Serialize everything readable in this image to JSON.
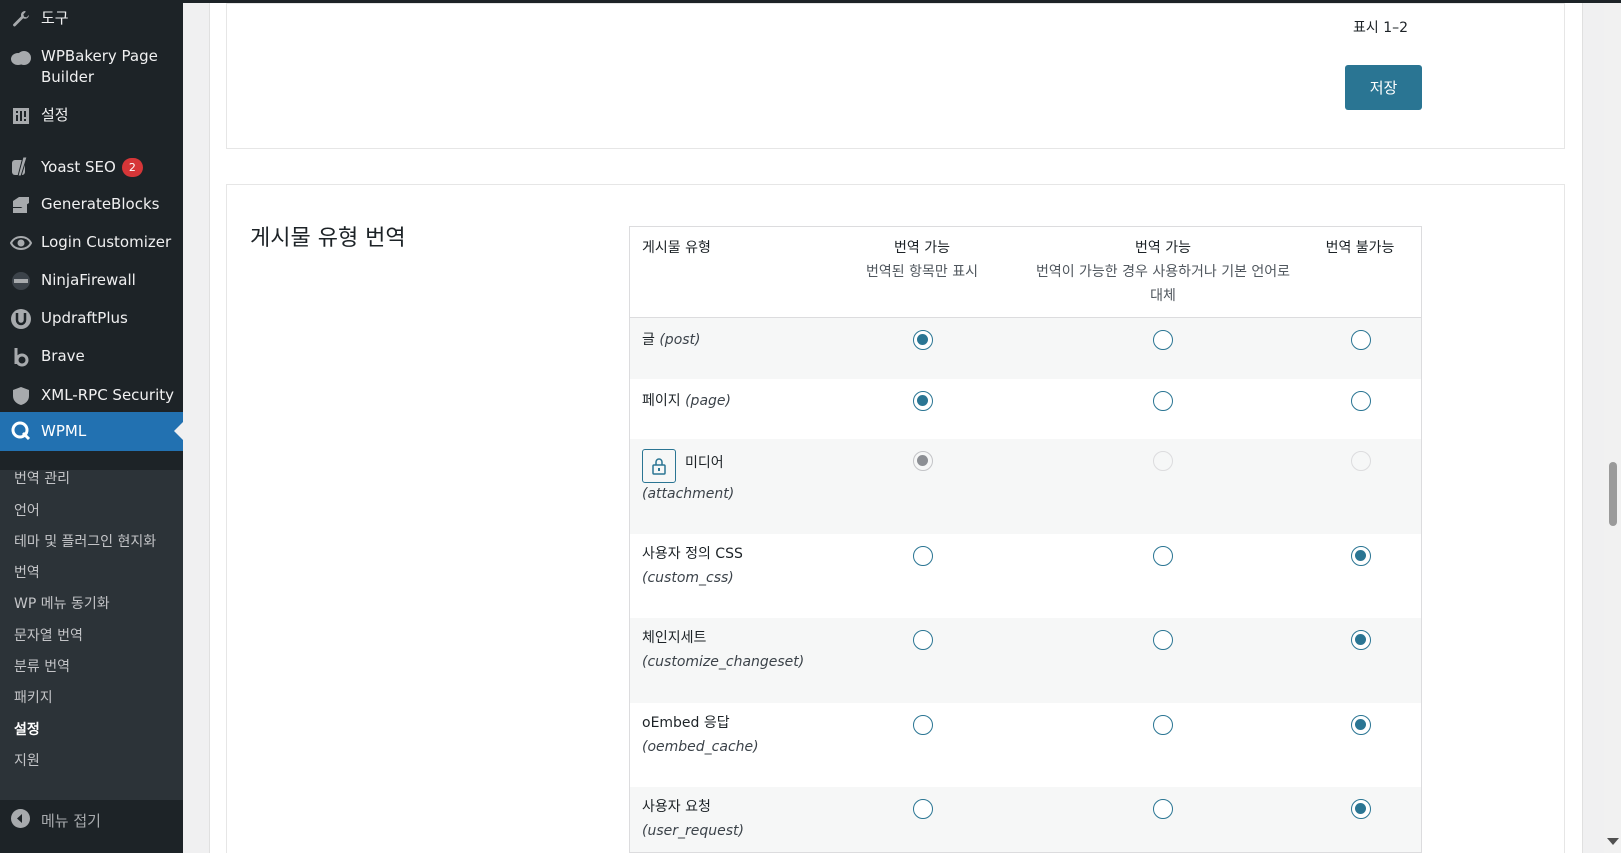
{
  "sidebar": {
    "items": [
      {
        "label": "도구",
        "icon": "wrench-icon"
      },
      {
        "label": "WPBakery Page Builder",
        "icon": "cloud-icon"
      },
      {
        "label": "설정",
        "icon": "settings-icon"
      },
      {
        "label": "Yoast SEO",
        "icon": "yoast-icon",
        "badge": "2"
      },
      {
        "label": "GenerateBlocks",
        "icon": "generateblocks-icon"
      },
      {
        "label": "Login Customizer",
        "icon": "eye-icon"
      },
      {
        "label": "NinjaFirewall",
        "icon": "ninja-icon"
      },
      {
        "label": "UpdraftPlus",
        "icon": "updraft-icon"
      },
      {
        "label": "Brave",
        "icon": "brave-icon"
      },
      {
        "label": "XML-RPC Security",
        "icon": "shield-icon"
      },
      {
        "label": "WPML",
        "icon": "wpml-icon"
      }
    ],
    "wpml_submenu": [
      "번역 관리",
      "언어",
      "테마 및 플러그인 현지화",
      "번역",
      "WP 메뉴 동기화",
      "문자열 번역",
      "분류 번역",
      "패키지",
      "설정",
      "지원"
    ],
    "collapse_label": "메뉴 접기"
  },
  "top_box": {
    "showing": "표시 1–2",
    "save_label": "저장"
  },
  "post_types": {
    "title": "게시물 유형 번역",
    "headers": {
      "type": "게시물 유형",
      "col1_title": "번역 가능",
      "col1_sub": "번역된 항목만 표시",
      "col2_title": "번역 가능",
      "col2_sub": "번역이 가능한 경우 사용하거나 기본 언어로 대체",
      "col3_title": "번역 불가능"
    },
    "rows": [
      {
        "name": "글",
        "slug": "(post)",
        "selected": 1
      },
      {
        "name": "페이지",
        "slug": "(page)",
        "selected": 1
      },
      {
        "name": "미디어",
        "slug": "(attachment)",
        "selected": 1,
        "locked": true
      },
      {
        "name": "사용자 정의 CSS",
        "slug": "(custom_css)",
        "selected": 3
      },
      {
        "name": "체인지세트",
        "slug": "(customize_changeset)",
        "selected": 3
      },
      {
        "name": "oEmbed 응답",
        "slug": "(oembed_cache)",
        "selected": 3
      },
      {
        "name": "사용자 요청",
        "slug": "(user_request)",
        "selected": 3
      }
    ]
  },
  "colors": {
    "accent": "#2a7593",
    "wp_blue": "#2271b1",
    "sidebar_bg": "#1d2327",
    "badge": "#d63638"
  }
}
